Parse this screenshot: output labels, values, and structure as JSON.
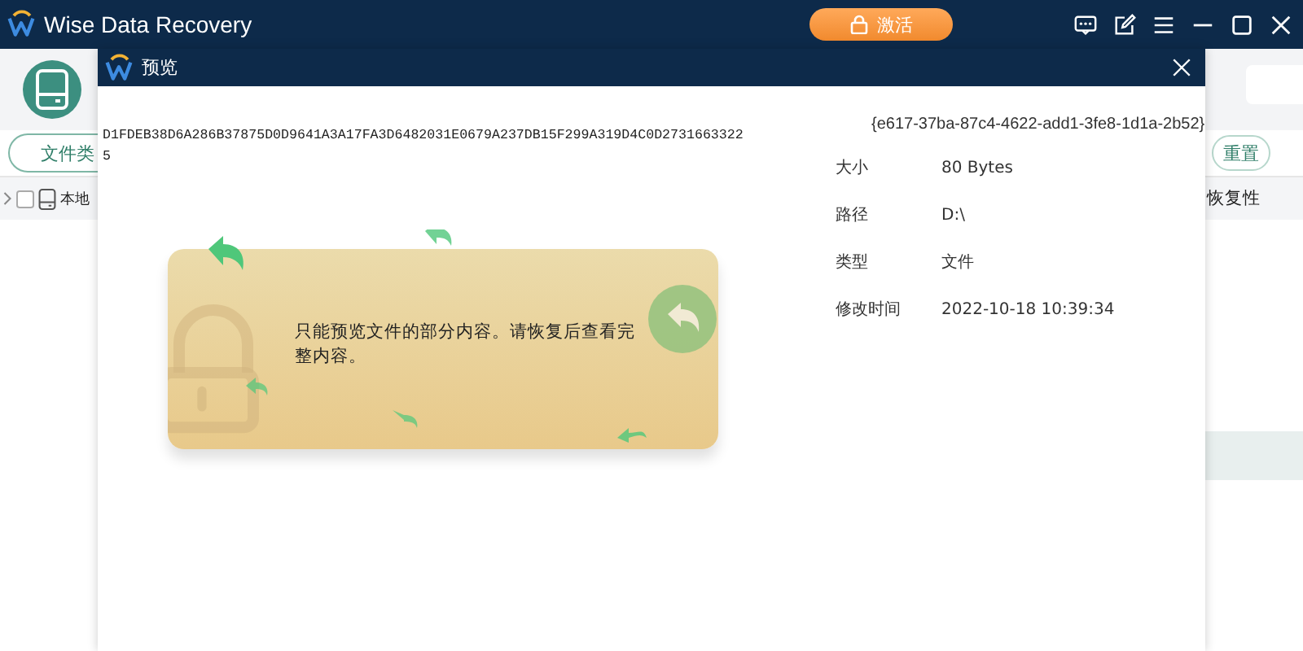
{
  "app": {
    "title": "Wise Data Recovery",
    "activate_button": "激活",
    "filter_button": "文件类",
    "reset_button": "重置",
    "tree": [
      {
        "label": "本地",
        "checked": false,
        "expanded": false
      }
    ],
    "column_header": "恢复性"
  },
  "preview": {
    "title": "预览",
    "content": "D1FDEB38D6A286B37875D0D9641A3A17FA3D6482031E0679A237DB15F299A319D4C0D27316633225",
    "guid": "{e617-37ba-87c4-4622-add1-3fe8-1d1a-2b52}",
    "properties": [
      {
        "label": "大小",
        "value": "80 Bytes"
      },
      {
        "label": "路径",
        "value": "D:\\"
      },
      {
        "label": "类型",
        "value": "文件"
      },
      {
        "label": "修改时间",
        "value": "2022-10-18 10:39:34"
      }
    ],
    "notice": "只能预览文件的部分内容。请恢复后查看完整内容。"
  }
}
